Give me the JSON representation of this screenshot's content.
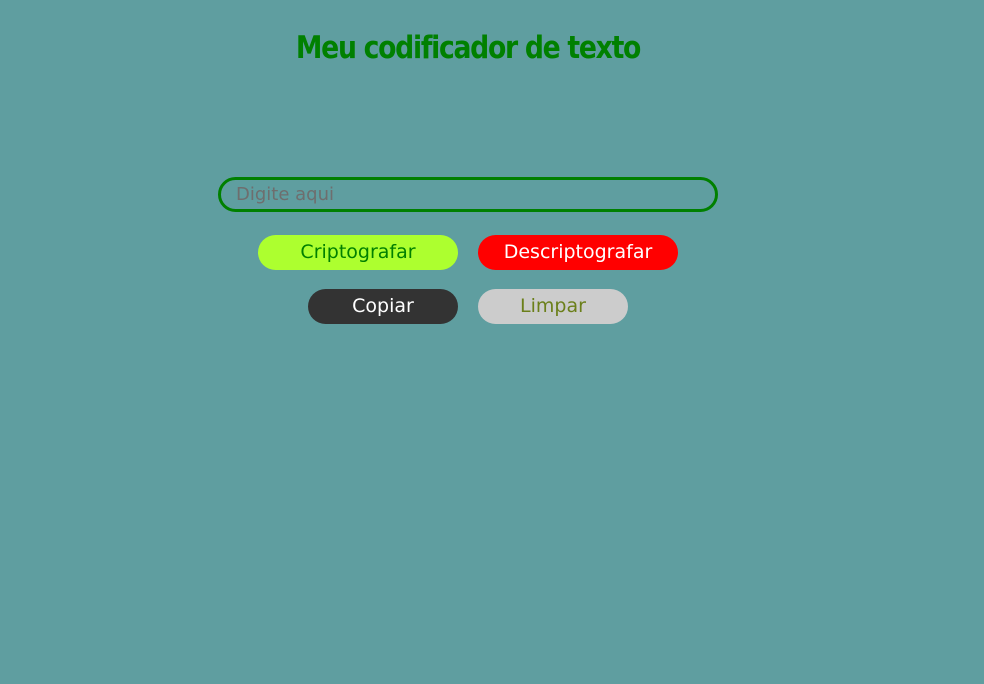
{
  "page": {
    "title": "Meu codificador de texto",
    "title_color": "#008000",
    "background_color": "#5f9ea0"
  },
  "input": {
    "placeholder": "Digite aqui",
    "value": "",
    "border_color": "#008000"
  },
  "buttons": {
    "encrypt": {
      "label": "Criptografar",
      "background": "#adff2f",
      "color": "#008000"
    },
    "decrypt": {
      "label": "Descriptografar",
      "background": "#ff0000",
      "color": "#ffffff"
    },
    "copy": {
      "label": "Copiar",
      "background": "#333333",
      "color": "#ffffff"
    },
    "clear": {
      "label": "Limpar",
      "background": "#cccccc",
      "color": "#6b7f1a"
    }
  }
}
